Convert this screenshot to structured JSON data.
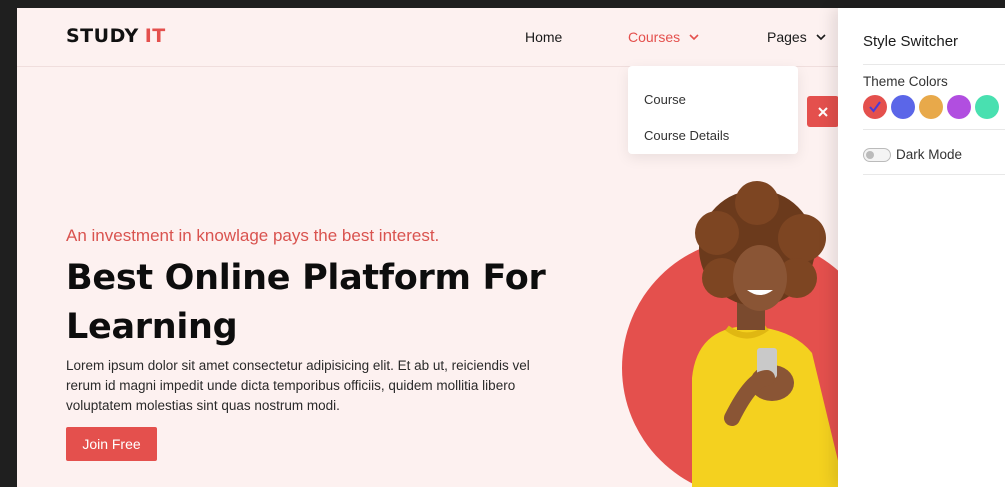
{
  "brand": {
    "part1": "STUDY",
    "part2": "IT",
    "accent_color": "#e4504d"
  },
  "nav": {
    "home": "Home",
    "courses": "Courses",
    "pages": "Pages",
    "courses_dropdown": [
      "Course",
      "Course Details"
    ]
  },
  "hero": {
    "tagline": "An investment in knowlage pays the best interest.",
    "title_line1": "Best Online Platform For",
    "title_line2": "Learning",
    "description": "Lorem ipsum dolor sit amet consectetur adipisicing elit. Et ab ut, reiciendis vel rerum id magni impedit unde dicta temporibus officiis, quidem mollitia libero voluptatem molestias sint quas nostrum modi.",
    "cta": "Join Free"
  },
  "switcher": {
    "title": "Style Switcher",
    "theme_label": "Theme Colors",
    "colors": [
      "#e4504d",
      "#5b66e8",
      "#e8a94a",
      "#b14ee0",
      "#49e0b0"
    ],
    "selected_color": "#e4504d",
    "dark_mode_label": "Dark Mode",
    "dark_mode_on": false
  },
  "icons": [
    "chevron-down-icon",
    "close-icon",
    "check-icon"
  ]
}
